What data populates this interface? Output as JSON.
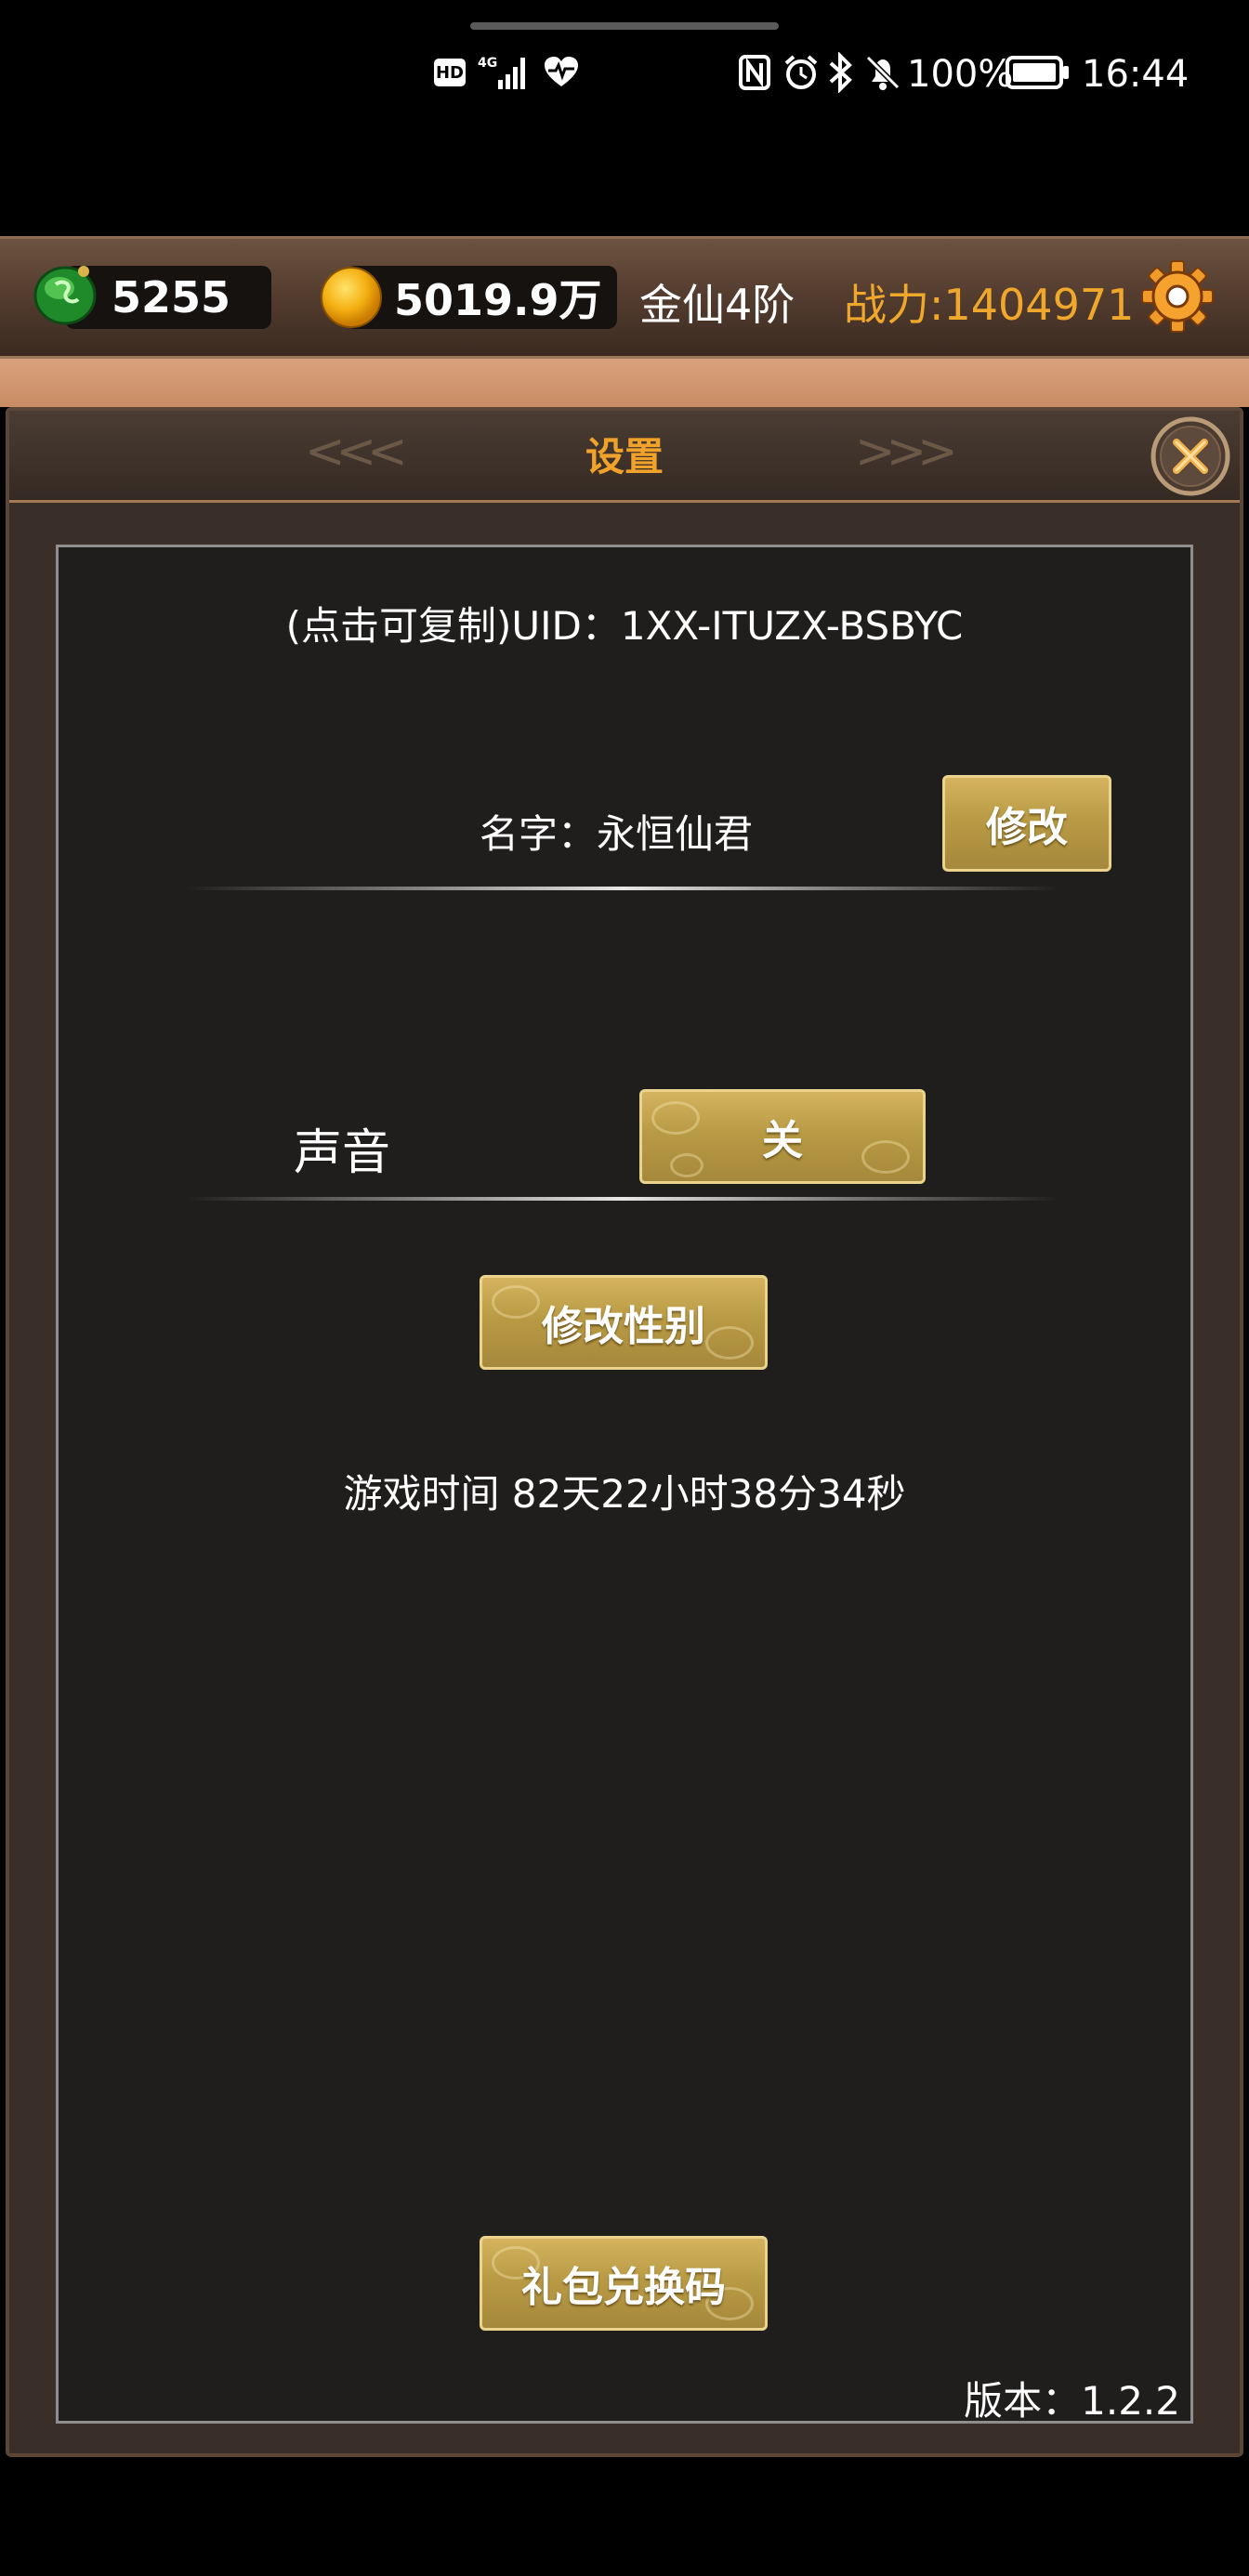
{
  "status_bar": {
    "time": "16:44",
    "battery": "100%",
    "network": "4G",
    "hd_label": "HD"
  },
  "top_bar": {
    "jade": "5255",
    "gold": "5019.9万",
    "rank": "金仙4阶",
    "power": "战力:1404971"
  },
  "panel": {
    "title": "设置",
    "uid_text": "(点击可复制)UID：1XX-ITUZX-BSBYC",
    "name_text": "名字：永恒仙君",
    "rename_button": "修改",
    "sound_label": "声音",
    "sound_button": "关",
    "gender_button": "修改性别",
    "play_time": "游戏时间 82天22小时38分34秒",
    "gift_code_button": "礼包兑换码",
    "version": "版本：1.2.2"
  },
  "colors": {
    "accent_gold": "#f0a22a",
    "button_gold": "#bfa04a",
    "panel_bg": "#201e1d"
  },
  "icons": {
    "jade": "jade-icon",
    "coin": "gold-coin-icon",
    "settings": "gear-icon",
    "close": "close-icon"
  }
}
